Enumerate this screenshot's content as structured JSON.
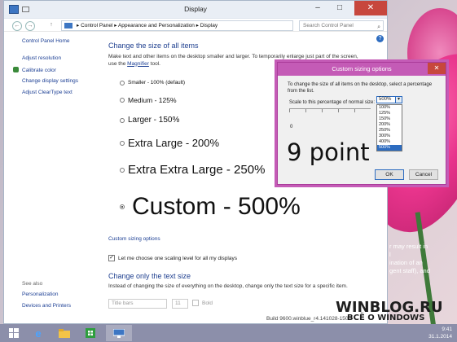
{
  "window": {
    "title": "Display",
    "min": "–",
    "max": "□",
    "close": "✕"
  },
  "address": {
    "back": "←",
    "forward": "→",
    "up": "↑",
    "breadcrumb": "▸ Control Panel ▸ Appearance and Personalization ▸ Display",
    "search_placeholder": "Search Control Panel",
    "search_icon": "⌕"
  },
  "help": "?",
  "sidebar": {
    "items": [
      {
        "label": "Control Panel Home"
      },
      {
        "label": "Adjust resolution"
      },
      {
        "label": "Calibrate color"
      },
      {
        "label": "Change display settings"
      },
      {
        "label": "Adjust ClearType text"
      }
    ],
    "see_also": "See also",
    "see_also_items": [
      {
        "label": "Personalization"
      },
      {
        "label": "Devices and Printers"
      }
    ]
  },
  "main": {
    "heading": "Change the size of all items",
    "description_1": "Make text and other items on the desktop smaller and larger. To temporarily enlarge just part of the screen,",
    "description_2a": "use the ",
    "magnifier_link": "Magnifier",
    "description_2b": " tool.",
    "options": [
      {
        "label": "Smaller - 100% (default)",
        "selected": false
      },
      {
        "label": "Medium - 125%",
        "selected": false
      },
      {
        "label": "Larger - 150%",
        "selected": false
      },
      {
        "label": "Extra Large - 200%",
        "selected": false
      },
      {
        "label": "Extra Extra Large - 250%",
        "selected": false
      },
      {
        "label": "Custom - 500%",
        "selected": true
      }
    ],
    "custom_sizing_link": "Custom sizing options",
    "checkbox_label": "Let me choose one scaling level for all my displays",
    "checkbox_checked": true,
    "heading_2": "Change only the text size",
    "description_3": "Instead of changing the size of everything on the desktop, change only the text size for a specific item.",
    "item_select": "Title bars",
    "size_select": "11",
    "bold_label": "Bold"
  },
  "dialog": {
    "title": "Custom sizing options",
    "close": "✕",
    "description": "To change the size of all items on the desktop, select a percentage from the list.",
    "scale_label": "Scale to this percentage of normal size:",
    "selected_value": "500%",
    "dropdown_arrow": "▾",
    "options": [
      "100%",
      "125%",
      "150%",
      "200%",
      "250%",
      "300%",
      "400%",
      "500%"
    ],
    "ruler_zero": "0",
    "preview": "9 point",
    "ok": "OK",
    "cancel": "Cancel"
  },
  "desktop": {
    "text": [
      "r may result in",
      "l",
      "ination of an",
      "gent staff), and"
    ],
    "build": "Build 9600.winblue_r4.141028-1500",
    "watermark": "WINBLOG.RU",
    "watermark_sub": "ВСЁ О WINDOWS"
  },
  "taskbar": {
    "icons": [
      "ie-icon",
      "explorer-icon",
      "store-icon",
      "display-settings-icon"
    ],
    "time": "9:41",
    "date": "31.1.2014"
  }
}
